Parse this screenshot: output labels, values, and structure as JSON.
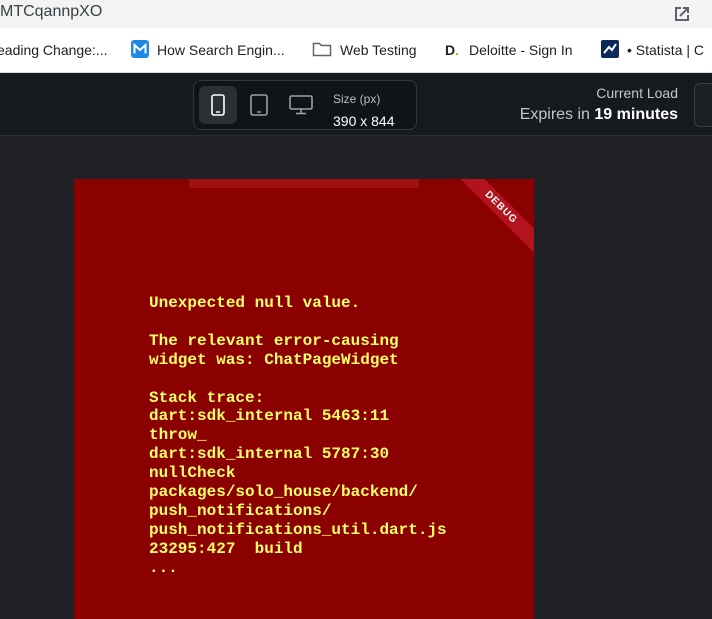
{
  "browser": {
    "url_fragment": "MTCqannpXO",
    "bookmarks": [
      {
        "label": "eading Change:...",
        "icon": "none"
      },
      {
        "label": "How Search Engin...",
        "icon": "m-logo-icon"
      },
      {
        "label": "Web Testing",
        "icon": "folder-icon"
      },
      {
        "label": "Deloitte - Sign In",
        "icon": "deloitte-icon"
      },
      {
        "label": "• Statista | C",
        "icon": "statista-icon"
      }
    ]
  },
  "toolbar": {
    "size_label": "Size (px)",
    "size_value": "390 x 844",
    "load_label": "Current Load",
    "expires_prefix": "Expires in ",
    "expires_value": "19 minutes"
  },
  "device": {
    "debug_label": "DEBUG",
    "error_text": "Unexpected null value.\n\nThe relevant error-causing\nwidget was: ChatPageWidget\n\nStack trace:\ndart:sdk_internal 5463:11\nthrow_\ndart:sdk_internal 5787:30\nnullCheck\npackages/solo_house/backend/\npush_notifications/\npush_notifications_util.dart.js\n23295:427  build\n..."
  },
  "colors": {
    "error_bg": "#8b0000",
    "error_text": "#ffff66",
    "toolbar_bg": "#16191d"
  }
}
